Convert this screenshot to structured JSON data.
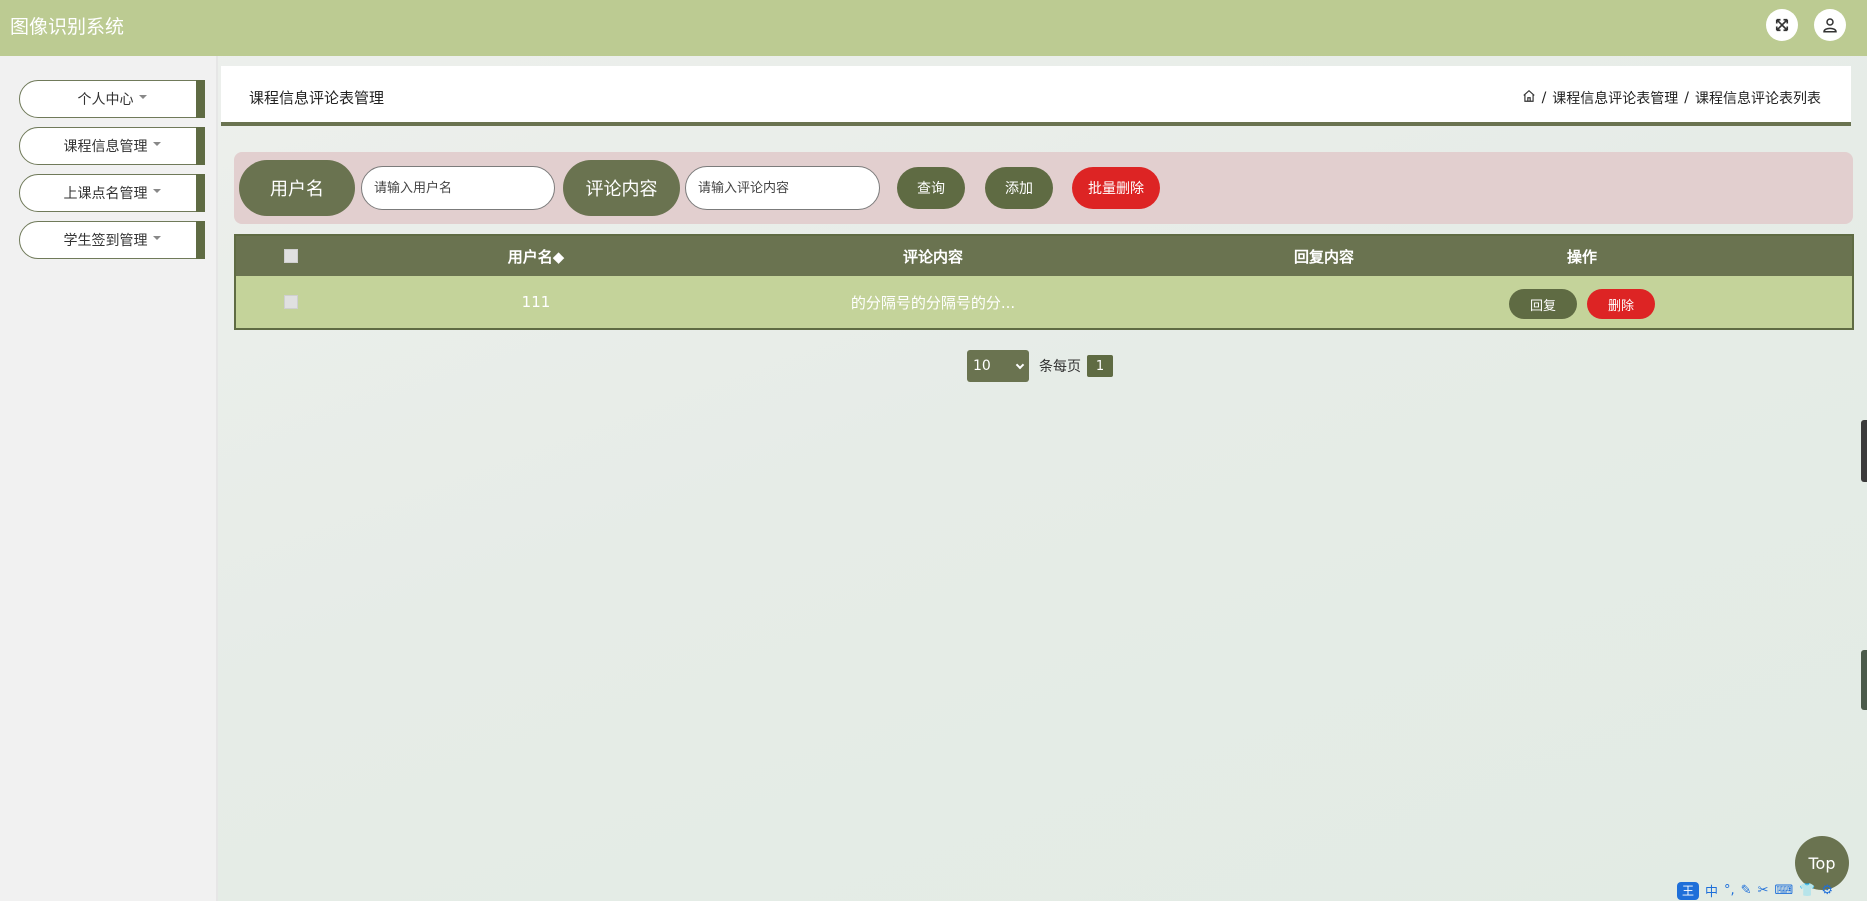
{
  "app": {
    "title": "图像识别系统"
  },
  "header_icons": [
    {
      "name": "fullscreen-icon"
    },
    {
      "name": "user-icon"
    }
  ],
  "sidebar": {
    "items": [
      {
        "label": "个人中心"
      },
      {
        "label": "课程信息管理"
      },
      {
        "label": "上课点名管理"
      },
      {
        "label": "学生签到管理"
      }
    ]
  },
  "page": {
    "title": "课程信息评论表管理",
    "breadcrumb": [
      "课程信息评论表管理",
      "课程信息评论表列表"
    ],
    "breadcrumb_sep": "/"
  },
  "search": {
    "username_label": "用户名",
    "username_placeholder": "请输入用户名",
    "content_label": "评论内容",
    "content_placeholder": "请输入评论内容",
    "query_btn": "查询",
    "add_btn": "添加",
    "batch_delete_btn": "批量删除"
  },
  "table": {
    "columns": [
      "用户名◆",
      "评论内容",
      "回复内容",
      "操作"
    ],
    "rows": [
      {
        "username": "111",
        "content": "的分隔号的分隔号的分...",
        "reply": ""
      }
    ],
    "reply_btn": "回复",
    "delete_btn": "删除"
  },
  "pagination": {
    "page_size": "10",
    "per_page_label": "条每页",
    "current_page": "1"
  },
  "top_button": "Top",
  "ime": {
    "badge": "王",
    "lang": "中"
  },
  "colors": {
    "header": "#bccb92",
    "olive": "#6a7350",
    "dark_olive": "#5f6b43",
    "red": "#dd2424",
    "row_bg": "#c4d39a",
    "search_bg": "#e2cfcf"
  }
}
